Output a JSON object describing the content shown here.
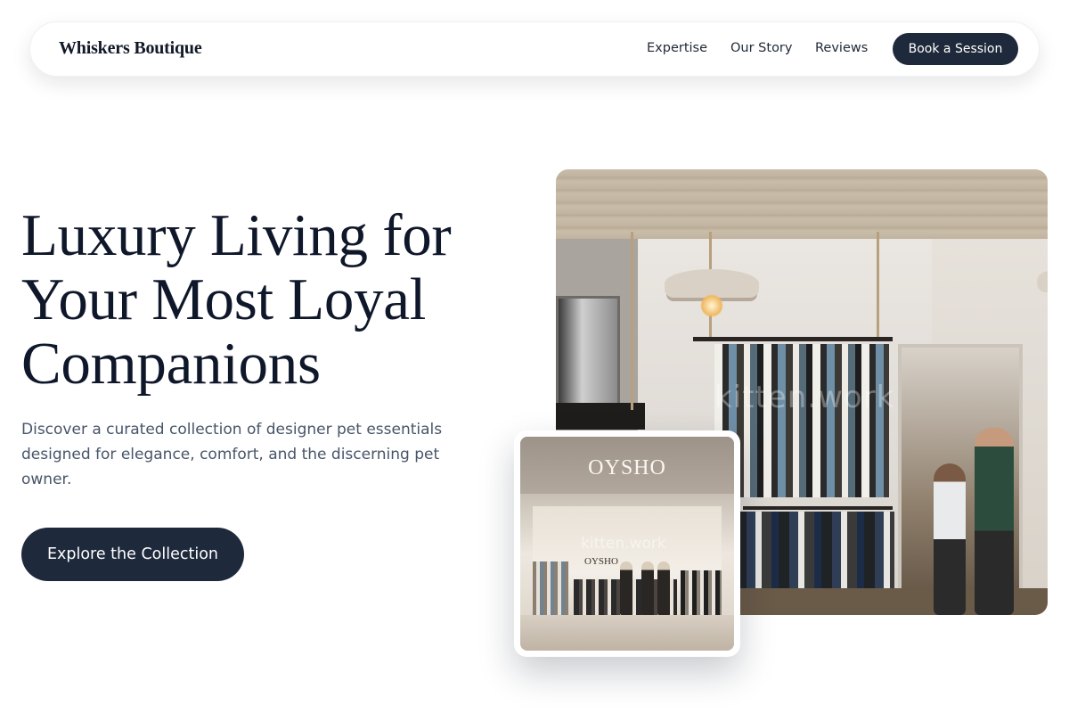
{
  "nav": {
    "brand": "Whiskers Boutique",
    "links": [
      "Expertise",
      "Our Story",
      "Reviews"
    ],
    "cta": "Book a Session"
  },
  "hero": {
    "title": "Luxury Living for Your Most Loyal Companions",
    "subtitle": "Discover a curated collection of designer pet essentials designed for elegance, comfort, and the discerning pet owner.",
    "cta": "Explore the Collection"
  },
  "images": {
    "main_watermark": "kitten.work",
    "inset_sign": "OYSHO",
    "inset_sign_small": "OYSHO",
    "inset_watermark": "kitten.work"
  },
  "colors": {
    "primary": "#1e293b",
    "heading": "#0f172a",
    "body_text": "#475569",
    "background": "#ffffff"
  }
}
